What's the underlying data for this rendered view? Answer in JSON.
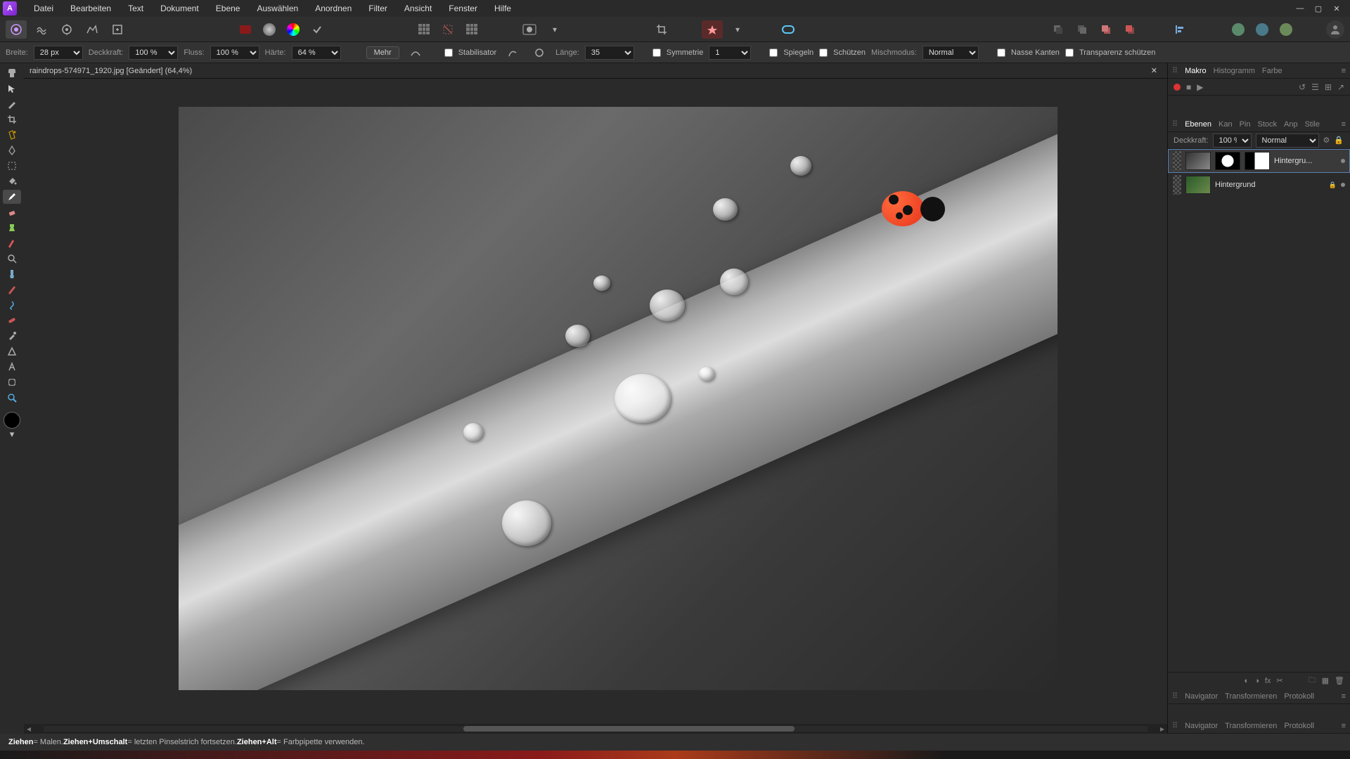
{
  "menubar": {
    "items": [
      "Datei",
      "Bearbeiten",
      "Text",
      "Dokument",
      "Ebene",
      "Auswählen",
      "Anordnen",
      "Filter",
      "Ansicht",
      "Fenster",
      "Hilfe"
    ]
  },
  "context": {
    "width_label": "Breite:",
    "width_value": "28 px",
    "opacity_label": "Deckkraft:",
    "opacity_value": "100 %",
    "flow_label": "Fluss:",
    "flow_value": "100 %",
    "hardness_label": "Härte:",
    "hardness_value": "64 %",
    "more": "Mehr",
    "stabilizer": "Stabilisator",
    "length_label": "Länge:",
    "length_value": "35",
    "symmetry": "Symmetrie",
    "symmetry_value": "1",
    "mirror": "Spiegeln",
    "protect": "Schützen",
    "blend_label": "Mischmodus:",
    "blend_value": "Normal",
    "wet_edges": "Nasse Kanten",
    "protect_alpha": "Transparenz schützen"
  },
  "document": {
    "tab_title": "raindrops-574971_1920.jpg [Geändert] (64,4%)"
  },
  "panels": {
    "macro_tabs": [
      "Makro",
      "Histogramm",
      "Farbe"
    ],
    "layer_tabs": [
      "Ebenen",
      "Kan",
      "Pin",
      "Stock",
      "Anp",
      "Stile"
    ],
    "layer_opacity_label": "Deckkraft:",
    "layer_opacity_value": "100 %",
    "layer_blend": "Normal",
    "layers": [
      {
        "name": "Hintergru..."
      },
      {
        "name": "Hintergrund"
      }
    ],
    "nav_tabs": [
      "Navigator",
      "Transformieren",
      "Protokoll"
    ],
    "nav_tabs2": [
      "Navigator",
      "Transformieren",
      "Protokoll"
    ]
  },
  "status": {
    "s1b": "Ziehen",
    "s1": " = Malen. ",
    "s2b": "Ziehen+Umschalt",
    "s2": " = letzten Pinselstrich fortsetzen. ",
    "s3b": "Ziehen+Alt",
    "s3": " = Farbpipette verwenden."
  }
}
